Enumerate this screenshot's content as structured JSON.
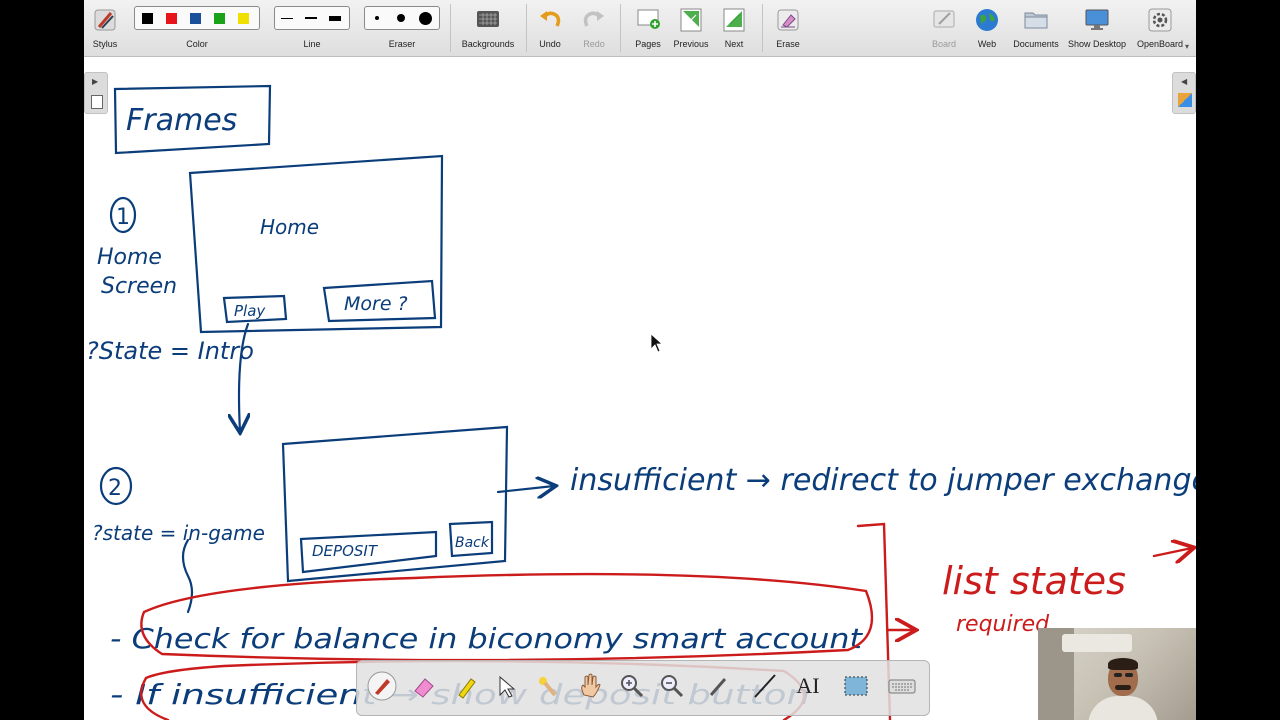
{
  "toolbar": {
    "stylus": "Stylus",
    "color": "Color",
    "line": "Line",
    "eraser": "Eraser",
    "backgrounds": "Backgrounds",
    "undo": "Undo",
    "redo": "Redo",
    "pages": "Pages",
    "previous": "Previous",
    "next": "Next",
    "erase": "Erase",
    "board": "Board",
    "web": "Web",
    "documents": "Documents",
    "show_desktop": "Show Desktop",
    "openboard": "OpenBoard"
  },
  "colors": {
    "palette": [
      "#000000",
      "#e8141b",
      "#1a4f9a",
      "#1aa31a",
      "#f0e000"
    ],
    "ink_blue": "#0b3d7a",
    "ink_red": "#cc1b1b"
  },
  "board": {
    "title": "Frames",
    "step1_number": "1",
    "step1_label_line1": "Home",
    "step1_label_line2": "Screen",
    "home_frame_title": "Home",
    "home_play_button": "Play",
    "home_more_button": "More ?",
    "state1": "?State = Intro",
    "step2_number": "2",
    "state2": "?state = in-game",
    "deposit_button": "DEPOSIT",
    "back_button": "Back",
    "arrow_note": "insufficient → redirect to jumper exchange",
    "list_states": "list states",
    "required": "required",
    "bullet1": "- Check for balance  in biconomy smart account",
    "bullet2": "- If  insufficient → show  deposit  button"
  },
  "float_toolbar": {
    "icons": [
      "pen-icon",
      "eraser-icon",
      "marker-icon",
      "selector-icon",
      "laser-pointer-icon",
      "hand-icon",
      "zoom-in-icon",
      "zoom-out-icon",
      "line-icon",
      "text-icon",
      "capture-icon",
      "keyboard-icon"
    ],
    "text_tool_label": "AI"
  }
}
